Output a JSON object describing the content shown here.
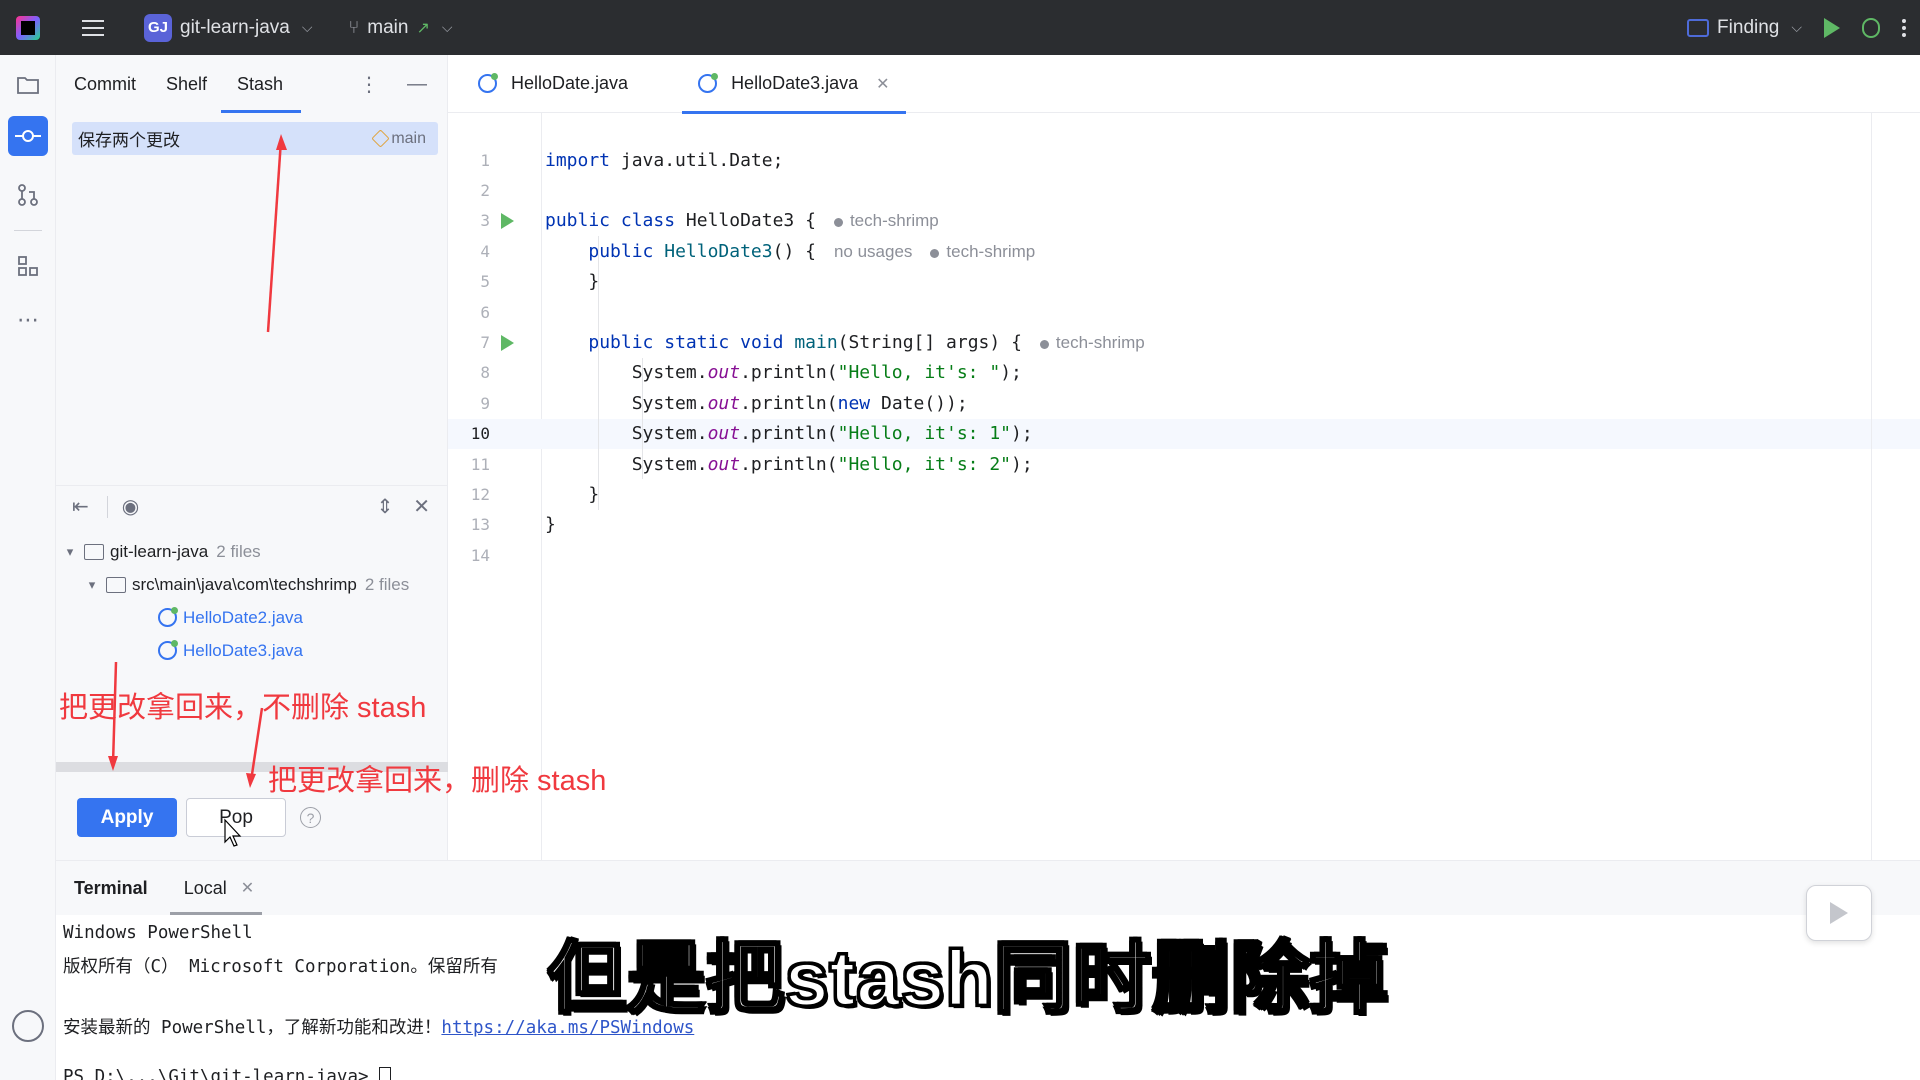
{
  "titlebar": {
    "project_badge": "GJ",
    "project_name": "git-learn-java",
    "branch": "main",
    "finding_label": "Finding"
  },
  "commit_panel": {
    "tabs": [
      "Commit",
      "Shelf",
      "Stash"
    ],
    "active_tab": "Stash",
    "stash_item": {
      "message": "保存两个更改",
      "branch": "main"
    },
    "tree": {
      "root": {
        "name": "git-learn-java",
        "count": "2 files"
      },
      "folder": {
        "name": "src\\main\\java\\com\\techshrimp",
        "count": "2 files"
      },
      "files": [
        "HelloDate2.java",
        "HelloDate3.java"
      ]
    },
    "apply_label": "Apply",
    "pop_label": "Pop",
    "help_label": "?"
  },
  "editor": {
    "tabs": [
      {
        "label": "HelloDate.java",
        "active": false
      },
      {
        "label": "HelloDate3.java",
        "active": true
      }
    ],
    "current_line": 10,
    "lines": [
      {
        "n": "1",
        "code": "import java.util.Date;"
      },
      {
        "n": "2",
        "code": ""
      },
      {
        "n": "3",
        "code": "public class HelloDate3 {",
        "hint": "tech-shrimp"
      },
      {
        "n": "4",
        "code": "    public HelloDate3() {",
        "hint_pre": "no usages",
        "hint": "tech-shrimp"
      },
      {
        "n": "5",
        "code": "    }"
      },
      {
        "n": "6",
        "code": ""
      },
      {
        "n": "7",
        "code": "    public static void main(String[] args) {",
        "hint": "tech-shrimp"
      },
      {
        "n": "8",
        "code": "        System.out.println(\"Hello, it's: \");"
      },
      {
        "n": "9",
        "code": "        System.out.println(new Date());"
      },
      {
        "n": "10",
        "code": "        System.out.println(\"Hello, it's: 1\");"
      },
      {
        "n": "11",
        "code": "        System.out.println(\"Hello, it's: 2\");"
      },
      {
        "n": "12",
        "code": "    }"
      },
      {
        "n": "13",
        "code": "}"
      },
      {
        "n": "14",
        "code": ""
      }
    ]
  },
  "terminal": {
    "tabs": [
      "Terminal",
      "Local"
    ],
    "lines": [
      "Windows PowerShell",
      "版权所有（C） Microsoft Corporation。保留所有",
      "",
      "安装最新的 PowerShell，了解新功能和改进！"
    ],
    "link": "https://aka.ms/PSWindows",
    "prompt_partial": "PS D:\\...\\Git\\git-learn-java> "
  },
  "annotations": {
    "apply_note": "把更改拿回来，不删除 stash",
    "pop_note": "把更改拿回来，删除 stash",
    "subtitle": "但是把stash同时删除掉"
  },
  "colors": {
    "accent": "#3574f0",
    "annotation": "#f0393f",
    "titlebar_bg": "#2b2d30"
  }
}
